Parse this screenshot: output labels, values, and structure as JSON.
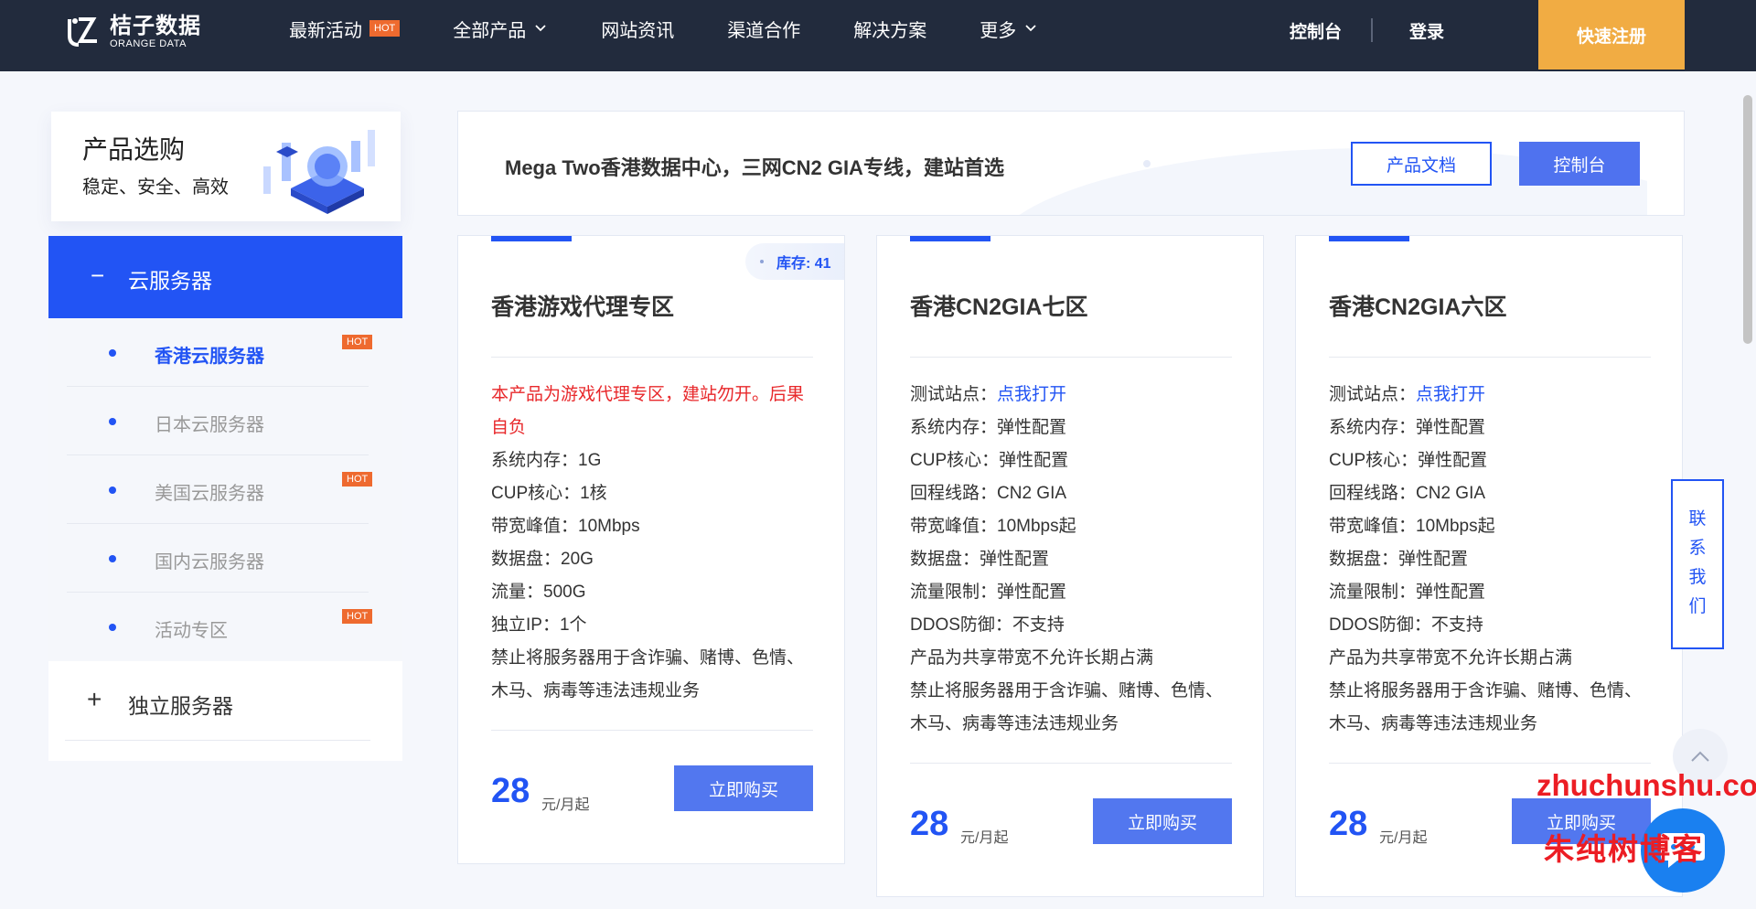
{
  "logo": {
    "cn": "桔子数据",
    "en": "ORANGE DATA"
  },
  "nav": {
    "items": [
      {
        "label": "最新活动",
        "badge": "HOT"
      },
      {
        "label": "全部产品"
      },
      {
        "label": "网站资讯"
      },
      {
        "label": "渠道合作"
      },
      {
        "label": "解决方案"
      },
      {
        "label": "更多"
      }
    ],
    "console": "控制台",
    "login": "登录",
    "register": "快速注册"
  },
  "sidebar": {
    "title": "产品选购",
    "subtitle": "稳定、安全、高效",
    "group1": {
      "sign": "−",
      "label": "云服务器"
    },
    "items": [
      {
        "label": "香港云服务器",
        "badge": "HOT"
      },
      {
        "label": "日本云服务器"
      },
      {
        "label": "美国云服务器",
        "badge": "HOT"
      },
      {
        "label": "国内云服务器"
      },
      {
        "label": "活动专区",
        "badge": "HOT"
      }
    ],
    "group2": {
      "sign": "+",
      "label": "独立服务器"
    }
  },
  "banner": {
    "text": "Mega Two香港数据中心，三网CN2 GIA专线，建站首选",
    "doc_button": "产品文档",
    "console_button": "控制台"
  },
  "cards": [
    {
      "title": "香港游戏代理专区",
      "stock": "库存: 41",
      "warning": "本产品为游戏代理专区，建站勿开。后果自负",
      "specs": [
        "系统内存：1G",
        "CUP核心：1核",
        "带宽峰值：10Mbps",
        "数据盘：20G",
        "流量：500G",
        "独立IP：1个",
        "禁止将服务器用于含诈骗、赌博、色情、木马、病毒等违法违规业务"
      ],
      "price": "28",
      "unit": "元/月起",
      "buy": "立即购买"
    },
    {
      "title": "香港CN2GIA七区",
      "test_label": "测试站点：",
      "test_link": "点我打开",
      "specs": [
        "系统内存：弹性配置",
        "CUP核心：弹性配置",
        "回程线路：CN2 GIA",
        "带宽峰值：10Mbps起",
        "数据盘：弹性配置",
        "流量限制：弹性配置",
        "DDOS防御：不支持",
        "产品为共享带宽不允许长期占满",
        "禁止将服务器用于含诈骗、赌博、色情、木马、病毒等违法违规业务"
      ],
      "price": "28",
      "unit": "元/月起",
      "buy": "立即购买"
    },
    {
      "title": "香港CN2GIA六区",
      "test_label": "测试站点：",
      "test_link": "点我打开",
      "specs": [
        "系统内存：弹性配置",
        "CUP核心：弹性配置",
        "回程线路：CN2 GIA",
        "带宽峰值：10Mbps起",
        "数据盘：弹性配置",
        "流量限制：弹性配置",
        "DDOS防御：不支持",
        "产品为共享带宽不允许长期占满",
        "禁止将服务器用于含诈骗、赌博、色情、木马、病毒等违法违规业务"
      ],
      "price": "28",
      "unit": "元/月起",
      "buy": "立即购买"
    }
  ],
  "float": {
    "contact": "联系我们"
  },
  "watermark": {
    "en": "zhuchunshu.com",
    "cn": "朱纯树博客"
  },
  "colors": {
    "nav_bg": "#222b3d",
    "accent": "#2254f4",
    "register": "#f1ac43",
    "hot": "#ee6a2f",
    "warning": "#e8282b"
  }
}
